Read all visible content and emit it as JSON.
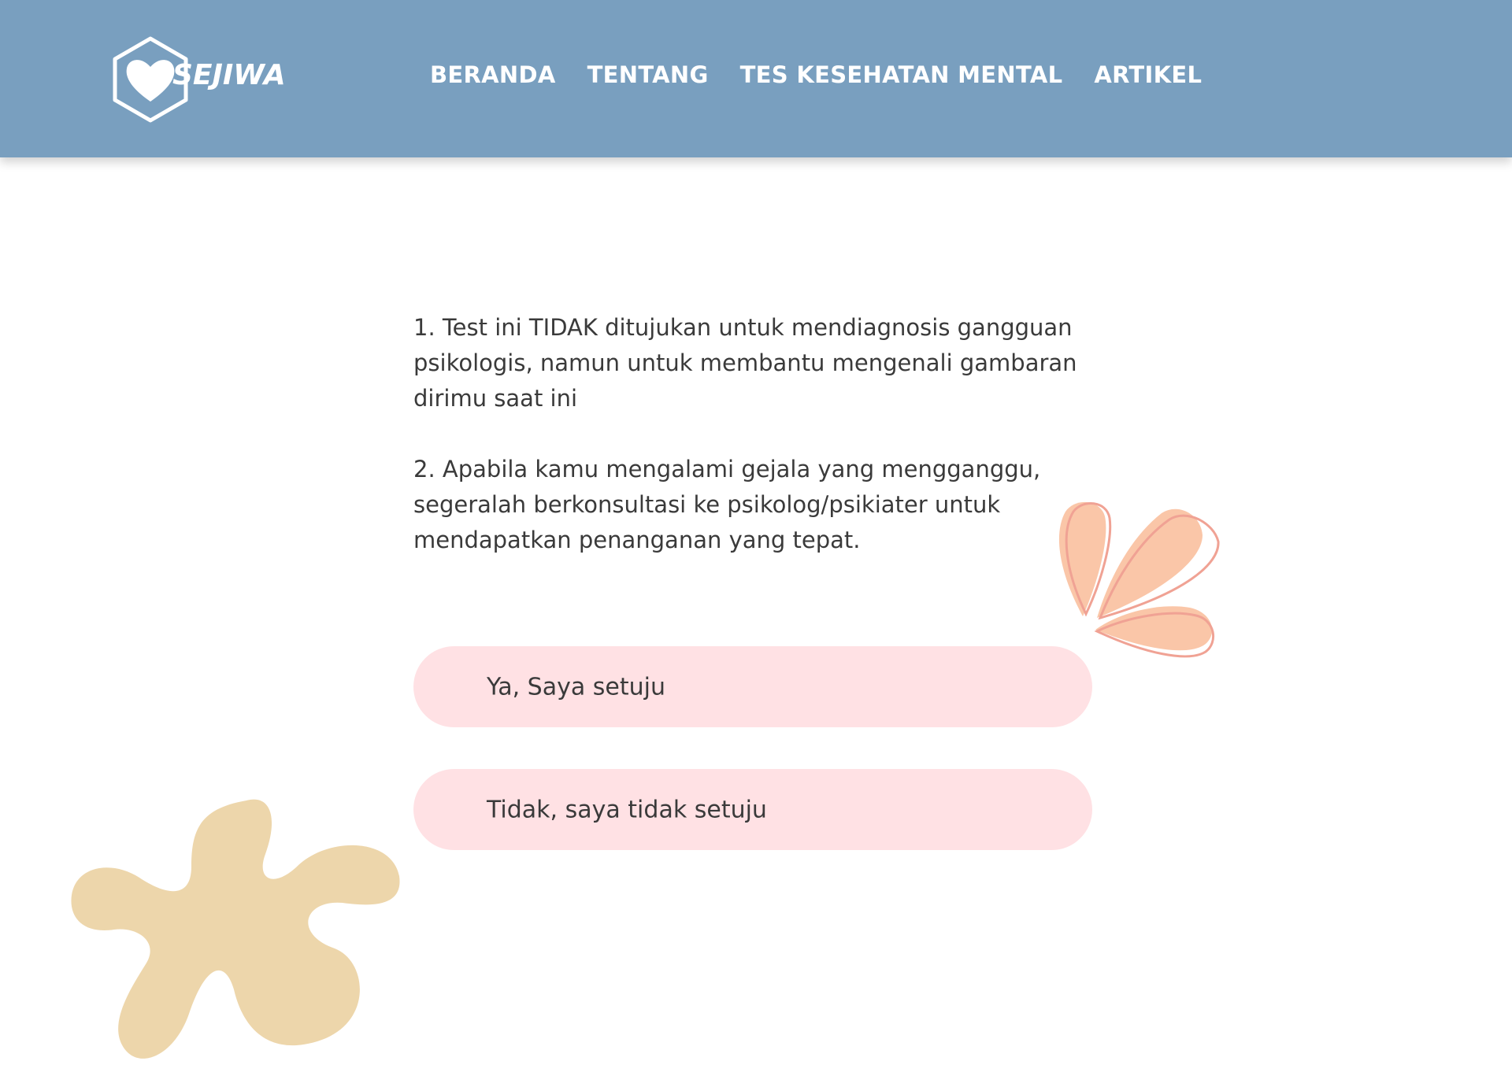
{
  "brand": {
    "name": "SEJIWA",
    "logo_icon": "heart-hexagon-icon"
  },
  "nav": {
    "items": [
      {
        "label": "BERANDA"
      },
      {
        "label": "TENTANG"
      },
      {
        "label": "TES KESEHATAN MENTAL"
      },
      {
        "label": "ARTIKEL"
      }
    ]
  },
  "notes": [
    {
      "text": "1. Test ini TIDAK ditujukan untuk mendiagnosis gangguan psikologis, namun untuk membantu mengenali gambaran dirimu saat ini"
    },
    {
      "text": "2. Apabila kamu mengalami gejala yang mengganggu, segeralah berkonsultasi ke psikolog/psikiater untuk mendapatkan penanganan yang tepat."
    }
  ],
  "answers": {
    "yes_label": "Ya, Saya setuju",
    "no_label": "Tidak, saya tidak setuju"
  },
  "colors": {
    "header_bg": "#799fbf",
    "button_bg": "#ffe1e4",
    "petal_fill": "#fac6a8",
    "petal_stroke": "#f0a294",
    "blob_fill": "#edd6ab",
    "text": "#3a3a3a"
  }
}
